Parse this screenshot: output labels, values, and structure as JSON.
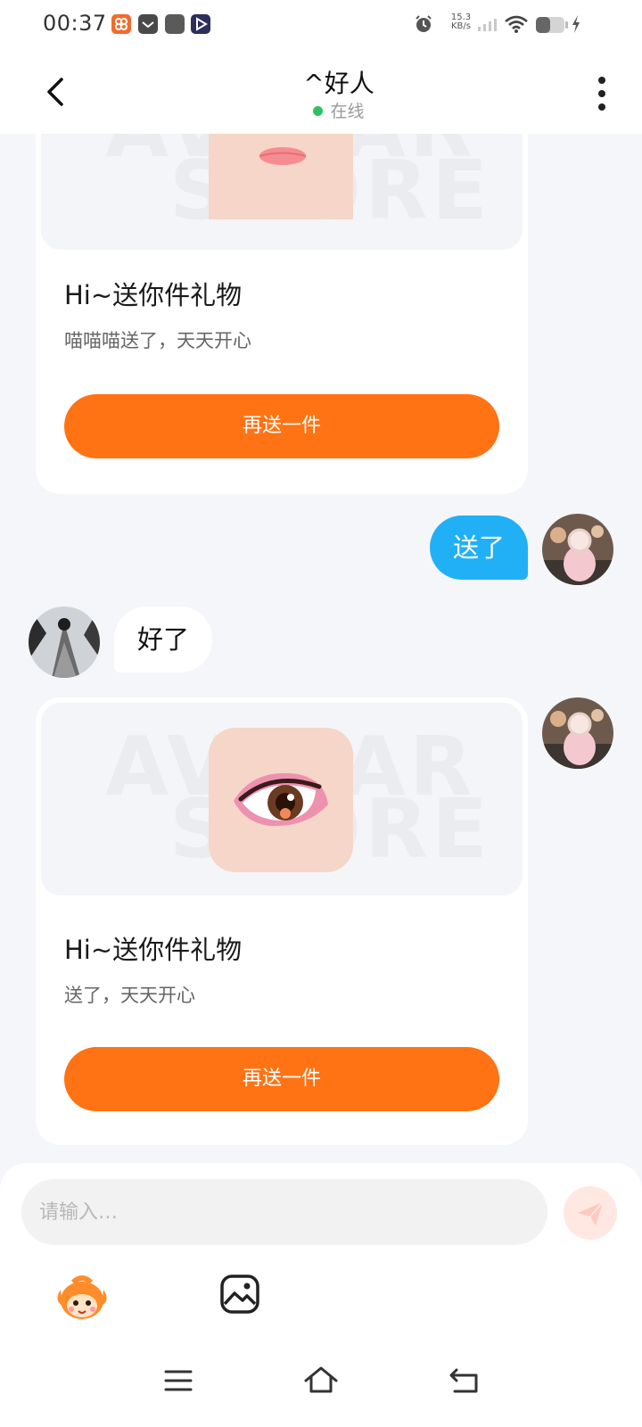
{
  "status_bar": {
    "time": "00:37",
    "net_speed_value": "15.3",
    "net_speed_unit": "KB/s",
    "battery_level": 0.5,
    "icons": [
      "app-orange-icon",
      "app-inbox-icon",
      "app-gray-icon",
      "app-video-icon",
      "alarm-icon",
      "signal-icon",
      "wifi-icon",
      "battery-icon",
      "charging-icon"
    ]
  },
  "header": {
    "title": "^好人",
    "presence": "在线",
    "presence_color": "#2ec25f"
  },
  "gift_cards": [
    {
      "title": "Hi~送你件礼物",
      "description": "喵喵喵送了，天天开心",
      "button_label": "再送一件",
      "watermark_top": "AVATAR",
      "watermark_bottom": "STORE",
      "gift_icon": "lips-icon"
    },
    {
      "title": "Hi~送你件礼物",
      "description": "送了，天天开心",
      "button_label": "再送一件",
      "watermark_top": "AVATAR",
      "watermark_bottom": "STORE",
      "gift_icon": "eye-icon"
    }
  ],
  "messages": [
    {
      "direction": "outgoing",
      "text": "送了"
    },
    {
      "direction": "incoming",
      "text": "好了"
    }
  ],
  "input": {
    "placeholder": "请输入…",
    "value": ""
  },
  "colors": {
    "accent": "#ff7314",
    "outgoing_bubble": "#21b0f5",
    "background": "#f4f6f9"
  },
  "toolbar_icons": [
    "mascot-sticker-icon",
    "image-icon",
    "send-icon"
  ],
  "nav_icons": [
    "menu-icon",
    "home-icon",
    "back-nav-icon"
  ]
}
